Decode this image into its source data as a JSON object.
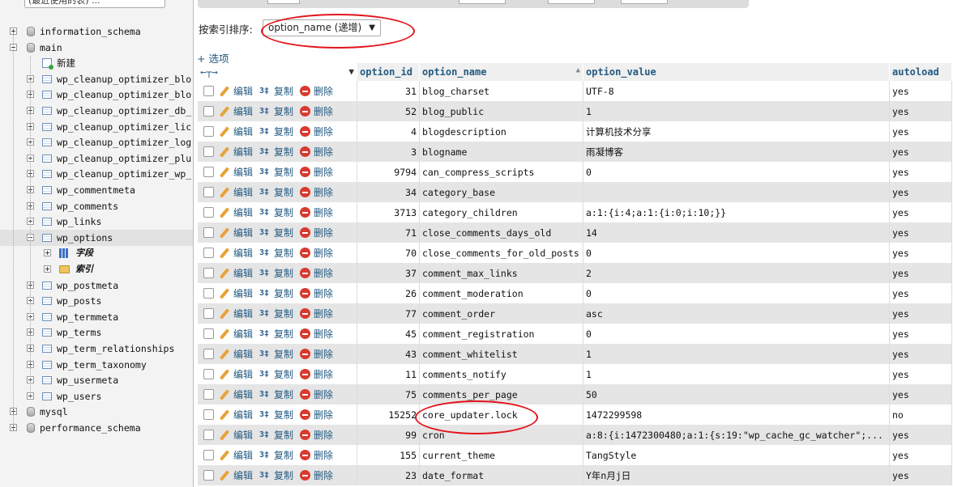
{
  "nav": {
    "recent_label": "(最近使用的表) ...",
    "items": [
      {
        "label": "information_schema",
        "type": "db",
        "level": 0,
        "expanded": false
      },
      {
        "label": "main",
        "type": "db",
        "level": 0,
        "expanded": true
      },
      {
        "label": "新建",
        "type": "new",
        "level": 1
      },
      {
        "label": "wp_cleanup_optimizer_blo",
        "type": "table",
        "level": 1
      },
      {
        "label": "wp_cleanup_optimizer_blo",
        "type": "table",
        "level": 1
      },
      {
        "label": "wp_cleanup_optimizer_db_",
        "type": "table",
        "level": 1
      },
      {
        "label": "wp_cleanup_optimizer_lic",
        "type": "table",
        "level": 1
      },
      {
        "label": "wp_cleanup_optimizer_log",
        "type": "table",
        "level": 1
      },
      {
        "label": "wp_cleanup_optimizer_plu",
        "type": "table",
        "level": 1
      },
      {
        "label": "wp_cleanup_optimizer_wp_",
        "type": "table",
        "level": 1
      },
      {
        "label": "wp_commentmeta",
        "type": "table",
        "level": 1
      },
      {
        "label": "wp_comments",
        "type": "table",
        "level": 1
      },
      {
        "label": "wp_links",
        "type": "table",
        "level": 1
      },
      {
        "label": "wp_options",
        "type": "table",
        "level": 1,
        "expanded": true,
        "selected": true
      },
      {
        "label": "字段",
        "type": "columns",
        "level": 2
      },
      {
        "label": "索引",
        "type": "index",
        "level": 2
      },
      {
        "label": "wp_postmeta",
        "type": "table",
        "level": 1
      },
      {
        "label": "wp_posts",
        "type": "table",
        "level": 1
      },
      {
        "label": "wp_termmeta",
        "type": "table",
        "level": 1
      },
      {
        "label": "wp_terms",
        "type": "table",
        "level": 1
      },
      {
        "label": "wp_term_relationships",
        "type": "table",
        "level": 1
      },
      {
        "label": "wp_term_taxonomy",
        "type": "table",
        "level": 1
      },
      {
        "label": "wp_usermeta",
        "type": "table",
        "level": 1
      },
      {
        "label": "wp_users",
        "type": "table",
        "level": 1
      },
      {
        "label": "mysql",
        "type": "db",
        "level": 0,
        "expanded": false
      },
      {
        "label": "performance_schema",
        "type": "db",
        "level": 0,
        "expanded": false
      }
    ]
  },
  "toolbar": {
    "sort_label": "按索引排序:",
    "sort_value": "option_name (递增)",
    "options_link": "+ 选项"
  },
  "grid": {
    "headers": {
      "option_id": "option_id",
      "option_name": "option_name",
      "option_value": "option_value",
      "autoload": "autoload"
    },
    "actions": {
      "edit": "编辑",
      "copy": "复制",
      "delete": "删除"
    },
    "rows": [
      {
        "id": "31",
        "name": "blog_charset",
        "value": "UTF-8",
        "autoload": "yes"
      },
      {
        "id": "52",
        "name": "blog_public",
        "value": "1",
        "autoload": "yes"
      },
      {
        "id": "4",
        "name": "blogdescription",
        "value": "计算机技术分享",
        "autoload": "yes"
      },
      {
        "id": "3",
        "name": "blogname",
        "value": "雨凝博客",
        "autoload": "yes"
      },
      {
        "id": "9794",
        "name": "can_compress_scripts",
        "value": "0",
        "autoload": "yes"
      },
      {
        "id": "34",
        "name": "category_base",
        "value": "",
        "autoload": "yes"
      },
      {
        "id": "3713",
        "name": "category_children",
        "value": "a:1:{i:4;a:1:{i:0;i:10;}}",
        "autoload": "yes"
      },
      {
        "id": "71",
        "name": "close_comments_days_old",
        "value": "14",
        "autoload": "yes"
      },
      {
        "id": "70",
        "name": "close_comments_for_old_posts",
        "value": "0",
        "autoload": "yes"
      },
      {
        "id": "37",
        "name": "comment_max_links",
        "value": "2",
        "autoload": "yes"
      },
      {
        "id": "26",
        "name": "comment_moderation",
        "value": "0",
        "autoload": "yes"
      },
      {
        "id": "77",
        "name": "comment_order",
        "value": "asc",
        "autoload": "yes"
      },
      {
        "id": "45",
        "name": "comment_registration",
        "value": "0",
        "autoload": "yes"
      },
      {
        "id": "43",
        "name": "comment_whitelist",
        "value": "1",
        "autoload": "yes"
      },
      {
        "id": "11",
        "name": "comments_notify",
        "value": "1",
        "autoload": "yes"
      },
      {
        "id": "75",
        "name": "comments_per_page",
        "value": "50",
        "autoload": "yes"
      },
      {
        "id": "15252",
        "name": "core_updater.lock",
        "value": "1472299598",
        "autoload": "no"
      },
      {
        "id": "99",
        "name": "cron",
        "value": "a:8:{i:1472300480;a:1:{s:19:\"wp_cache_gc_watcher\";...",
        "autoload": "yes"
      },
      {
        "id": "155",
        "name": "current_theme",
        "value": "TangStyle",
        "autoload": "yes"
      },
      {
        "id": "23",
        "name": "date_format",
        "value": "Y年n月j日",
        "autoload": "yes"
      }
    ]
  },
  "colors": {
    "link": "#235a81",
    "highlight_ellipse": "#e3141b",
    "row_alt": "#e5e5e5"
  }
}
